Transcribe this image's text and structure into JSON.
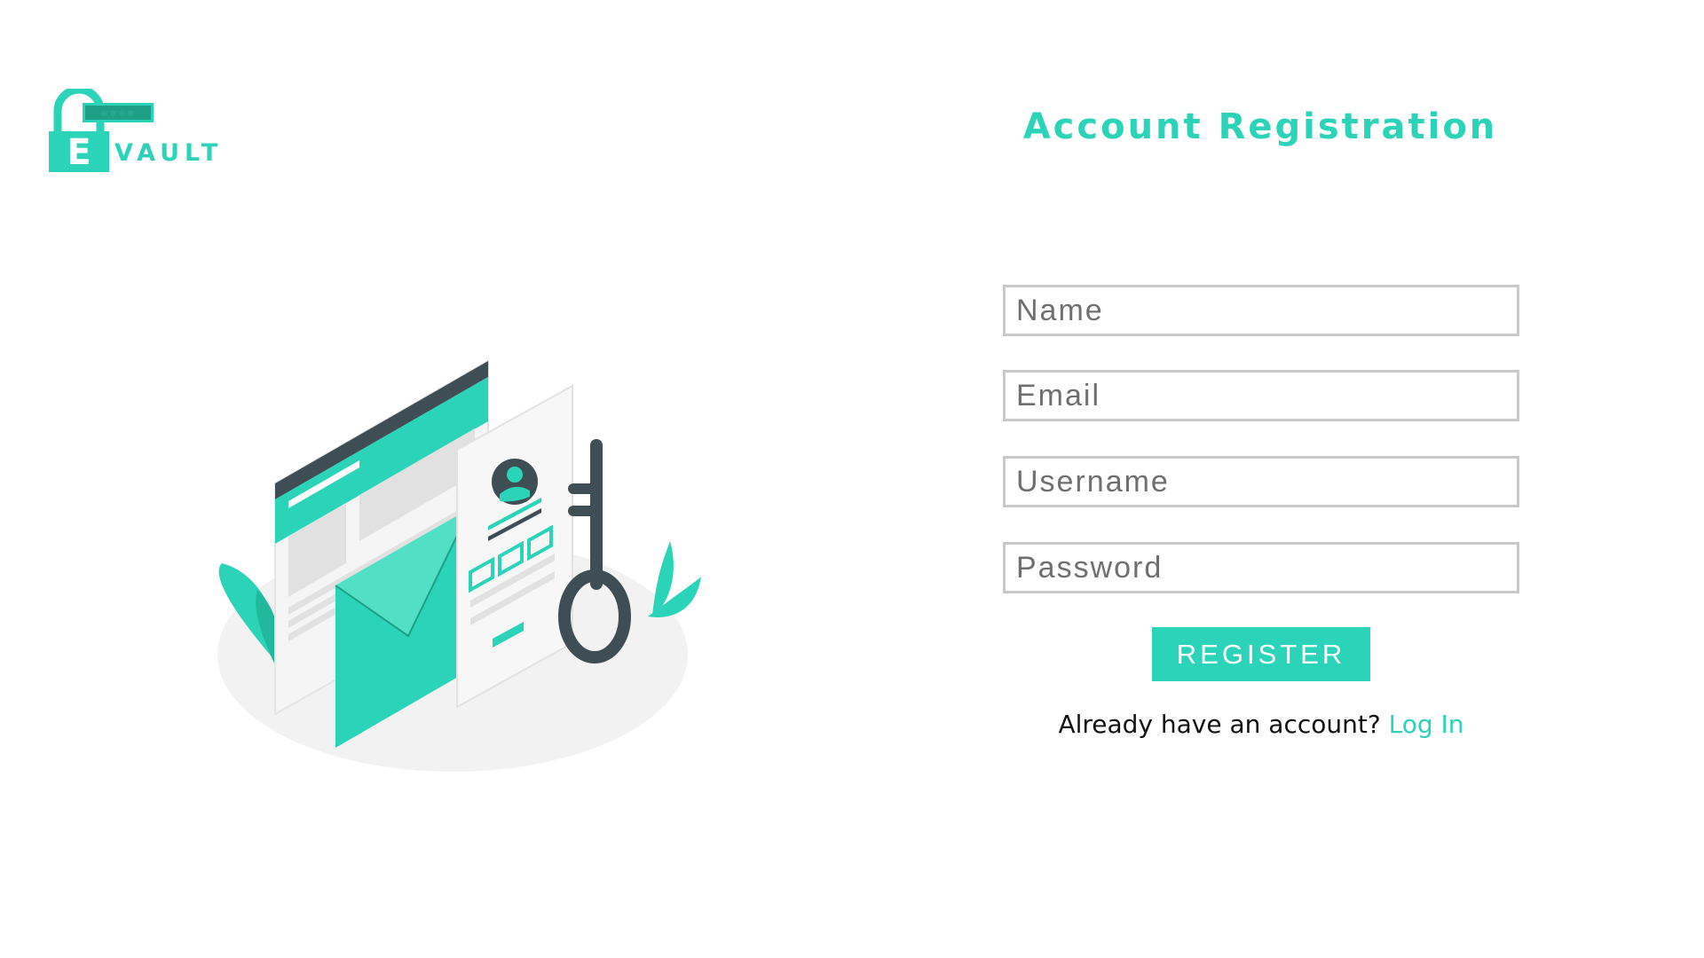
{
  "brand": {
    "logo_letter": "E",
    "logo_password_mask": "✱✱✱✱",
    "logo_word": "VAULT",
    "accent_color": "#2bd4b8",
    "logo_icon": "padlock-icon"
  },
  "illustration": {
    "icon": "registration-illustration"
  },
  "form": {
    "title": "Account Registration",
    "name_placeholder": "Name",
    "email_placeholder": "Email",
    "username_placeholder": "Username",
    "password_placeholder": "Password",
    "register_label": "REGISTER",
    "login_prompt": "Already have an account?",
    "login_link": "Log In"
  }
}
